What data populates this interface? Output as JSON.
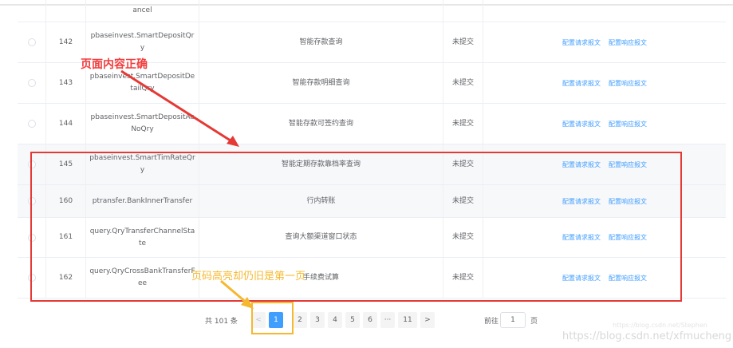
{
  "rows": [
    {
      "id": "",
      "name": "ancel",
      "desc": "",
      "status": ""
    },
    {
      "id": "142",
      "name": "pbaseinvest.SmartDepositQry",
      "desc": "智能存款查询",
      "status": "未提交"
    },
    {
      "id": "143",
      "name": "pbaseinvest.SmartDepositDetailQry",
      "desc": "智能存款明细查询",
      "status": "未提交"
    },
    {
      "id": "144",
      "name": "pbaseinvest.SmartDepositAcNoQry",
      "desc": "智能存款可签约查询",
      "status": "未提交"
    },
    {
      "id": "145",
      "name": "pbaseinvest.SmartTimRateQry",
      "desc": "智能定期存款靠档率查询",
      "status": "未提交"
    },
    {
      "id": "160",
      "name": "ptransfer.BankInnerTransfer",
      "desc": "行内转账",
      "status": "未提交"
    },
    {
      "id": "161",
      "name": "query.QryTransferChannelState",
      "desc": "查询大额渠道窗口状态",
      "status": "未提交"
    },
    {
      "id": "162",
      "name": "query.QryCrossBankTransferFee",
      "desc": "手续费试算",
      "status": "未提交"
    }
  ],
  "actions": {
    "request": "配置请求报文",
    "response": "配置响应报文"
  },
  "pagination": {
    "total": "共 101 条",
    "prev": "<",
    "pages": [
      "1",
      "2",
      "3",
      "4",
      "5",
      "6",
      "···",
      "11"
    ],
    "current": "1",
    "next": ">",
    "goto_label": "前往",
    "goto_value": "1",
    "page_unit": "页"
  },
  "annotations": {
    "correct": "页面内容正确",
    "wrong_page": "页码高亮却仍旧是第一页"
  },
  "watermark": {
    "small": "https://blog.csdn.net/Stephen",
    "large": "https://blog.csdn.net/xfmucheng"
  },
  "colors": {
    "accent": "#409eff",
    "red_annotation": "#e53935",
    "orange_annotation": "#f5b82e"
  }
}
